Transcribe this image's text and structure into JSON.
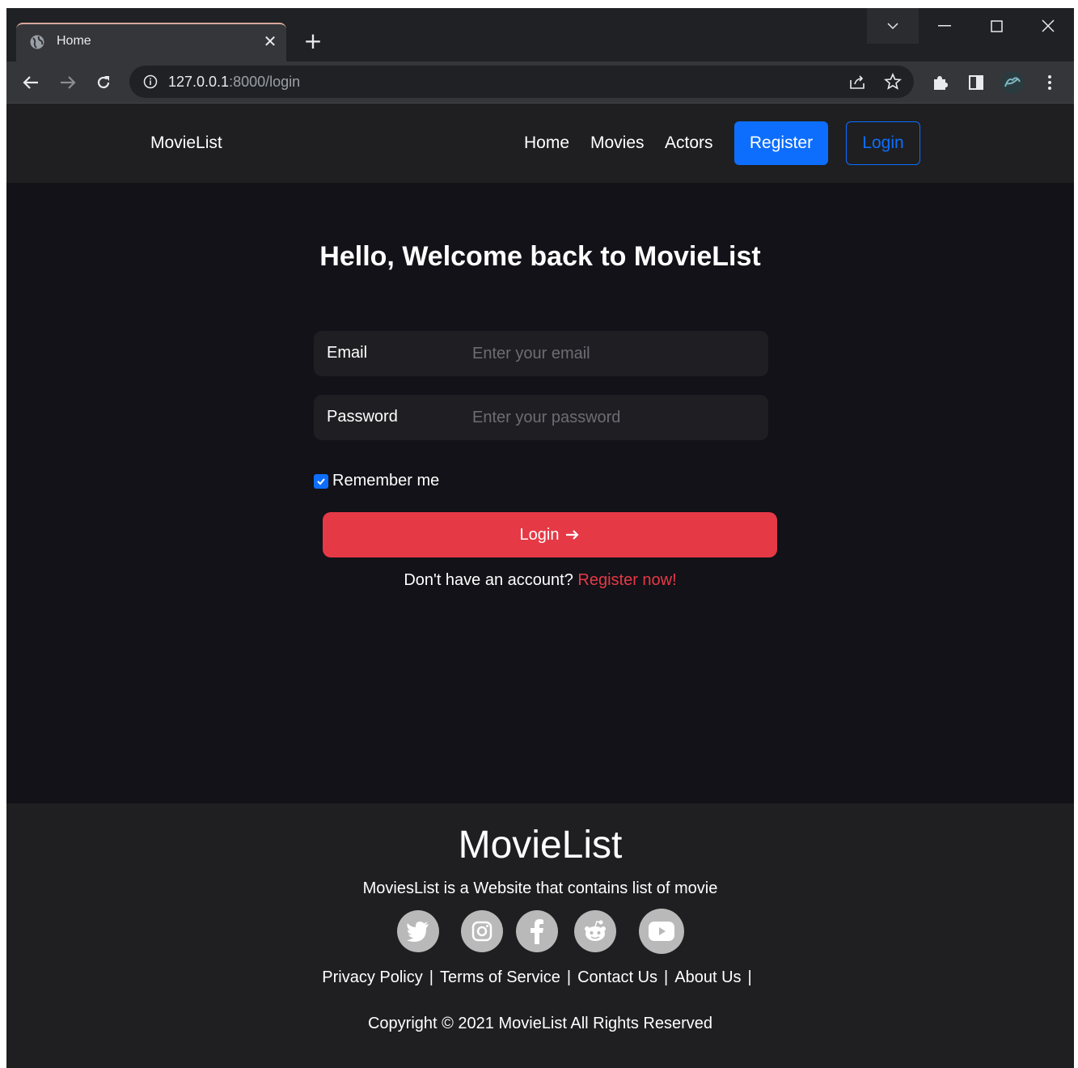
{
  "browser": {
    "tab_title": "Home",
    "url_host": "127.0.0.1",
    "url_path": ":8000/login"
  },
  "navbar": {
    "brand": "MovieList",
    "links": [
      "Home",
      "Movies",
      "Actors"
    ],
    "register_label": "Register",
    "login_label": "Login"
  },
  "login": {
    "heading": "Hello, Welcome back to MovieList",
    "email_label": "Email",
    "email_placeholder": "Enter your email",
    "password_label": "Password",
    "password_placeholder": "Enter your password",
    "remember_label": "Remember me",
    "remember_checked": true,
    "submit_label": "Login",
    "signup_prompt": "Don't have an account?",
    "signup_link": "Register now!"
  },
  "footer": {
    "brand": "MovieList",
    "tagline": "MoviesList is a Website that contains list of movie",
    "socials": [
      "twitter-icon",
      "instagram-icon",
      "facebook-icon",
      "reddit-icon",
      "youtube-icon"
    ],
    "links": [
      "Privacy Policy",
      "Terms of Service",
      "Contact Us",
      "About Us"
    ],
    "copyright": "Copyright © 2021 MovieList All Rights Reserved"
  },
  "colors": {
    "primary": "#0d6efd",
    "danger": "#e63946",
    "background": "#121218",
    "navbar": "#1f1f21"
  }
}
